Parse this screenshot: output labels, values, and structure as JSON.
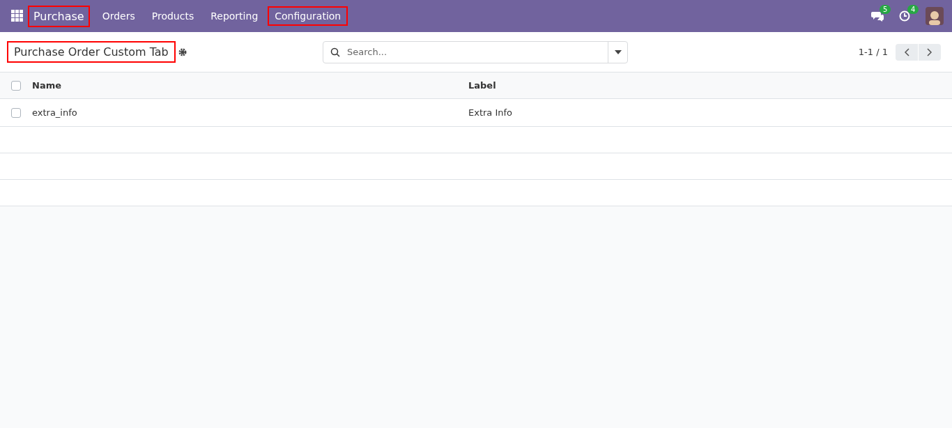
{
  "navbar": {
    "app": {
      "label": "Purchase",
      "highlighted": true
    },
    "menu": [
      {
        "label": "Orders",
        "highlighted": false
      },
      {
        "label": "Products",
        "highlighted": false
      },
      {
        "label": "Reporting",
        "highlighted": false
      },
      {
        "label": "Configuration",
        "highlighted": true
      }
    ],
    "messages_count": "5",
    "activities_count": "4"
  },
  "control_panel": {
    "title": {
      "label": "Purchase Order Custom Tab",
      "highlighted": true
    },
    "search": {
      "placeholder": "Search..."
    },
    "pager": "1-1 / 1"
  },
  "table": {
    "columns": [
      "Name",
      "Label"
    ],
    "all_checked": false,
    "rows": [
      {
        "checked": false,
        "cells": [
          "extra_info",
          "Extra Info"
        ]
      }
    ]
  }
}
